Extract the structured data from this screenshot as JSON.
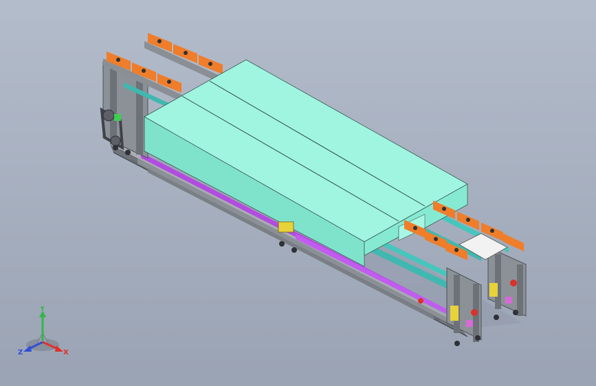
{
  "viewport": {
    "background_top": "#b3bccb",
    "background_bottom": "#9aa3b3"
  },
  "model": {
    "colors": {
      "frame": "#7f848c",
      "frame_dark": "#4d5157",
      "panel_cyan": "#8ff0d8",
      "panel_cyan_side": "#6fdcc6",
      "belt_purple": "#b24be0",
      "conveyor_teal": "#3fb8b0",
      "fixture_orange": "#ef7d2a",
      "fixture_white": "#f2f2f2",
      "yellow_part": "#e8d23a",
      "red_part": "#d8322a",
      "green_part": "#3ccf4e"
    }
  },
  "triad": {
    "x_label": "X",
    "y_label": "Y",
    "z_label": "Z",
    "x_color": "#e0302a",
    "y_color": "#35b54a",
    "z_color": "#2f4fd6"
  }
}
